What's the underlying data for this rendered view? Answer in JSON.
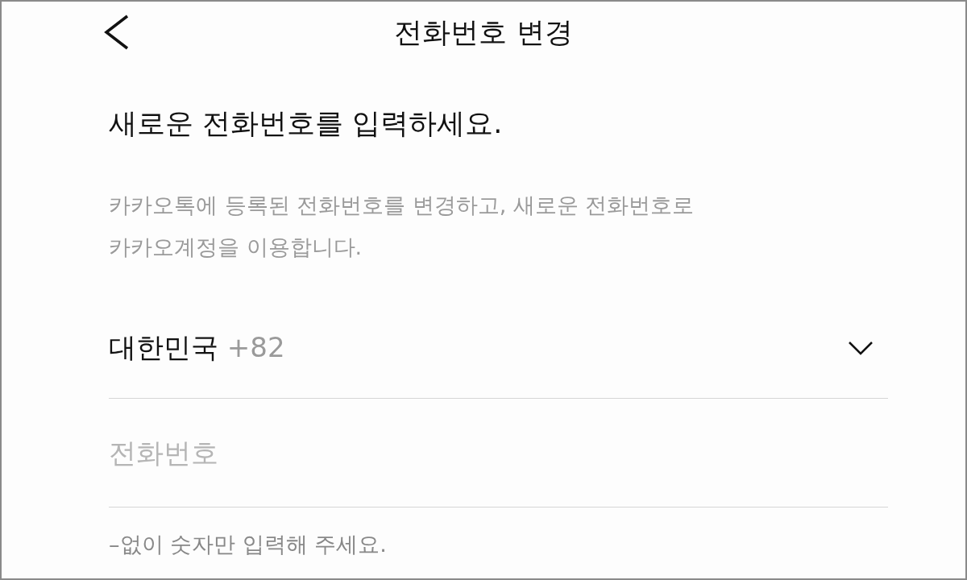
{
  "header": {
    "title": "전화번호 변경"
  },
  "heading": "새로운 전화번호를 입력하세요.",
  "description": "카카오톡에 등록된 전화번호를 변경하고, 새로운 전화번호로\n카카오계정을 이용합니다.",
  "country": {
    "name": "대한민국",
    "code": "+82"
  },
  "phone_field": {
    "placeholder": "전화번호"
  },
  "hint": "–없이 숫자만 입력해 주세요."
}
